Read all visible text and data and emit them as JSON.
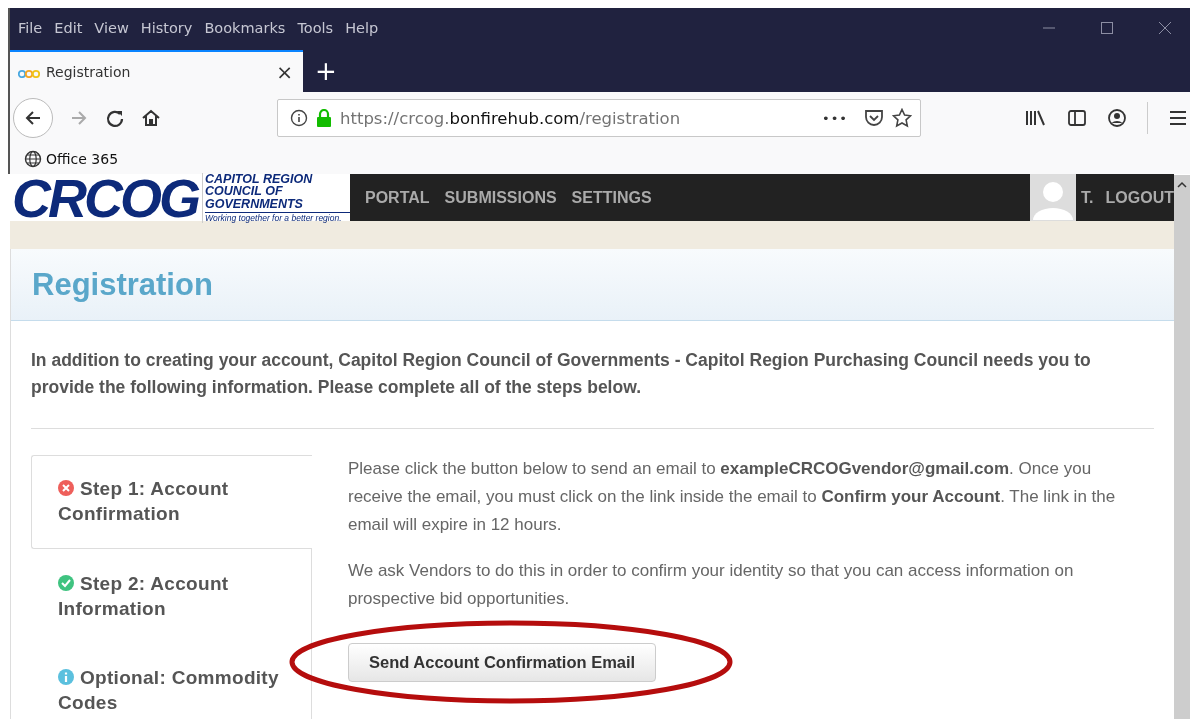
{
  "menu_bar": {
    "items": [
      "File",
      "Edit",
      "View",
      "History",
      "Bookmarks",
      "Tools",
      "Help"
    ]
  },
  "tab": {
    "title": "Registration",
    "close": "×",
    "new_tab": "+"
  },
  "toolbar": {
    "url": {
      "prefix": "https://crcog.",
      "domain": "bonfirehub.com",
      "path": "/registration"
    },
    "page_actions": "•••"
  },
  "bookmarks": [
    {
      "label": "Office 365"
    }
  ],
  "site_header": {
    "logo": {
      "mark": "CRCOG",
      "line_1": "CAPITOL REGION",
      "line_2": "COUNCIL OF GOVERNMENTS",
      "tagline": "Working together for a better region."
    },
    "nav": [
      "PORTAL",
      "SUBMISSIONS",
      "SETTINGS"
    ],
    "user": "T.",
    "logout": "LOGOUT"
  },
  "page": {
    "title": "Registration",
    "intro": "In addition to creating your account, Capitol Region Council of Governments - Capitol Region Purchasing Council needs you to provide the following information. Please complete all of the steps below.",
    "steps": [
      {
        "kind": "error",
        "label": "Step 1: Account Confirmation",
        "selected": true
      },
      {
        "kind": "done",
        "label": "Step 2: Account Information",
        "selected": false
      },
      {
        "kind": "info",
        "label": "Optional: Commodity Codes",
        "selected": false
      }
    ],
    "paragraphs": [
      "Please click the button below to send an email to **exampleCRCOGvendor@gmail.com**. Once you receive the email, you must click on the link inside the email to **Confirm your Account**. The link in the email will expire in 12 hours.",
      "We ask Vendors to do this in order to confirm your identity so that you can access information on prospective bid opportunities."
    ],
    "button": "Send Account Confirmation Email"
  }
}
